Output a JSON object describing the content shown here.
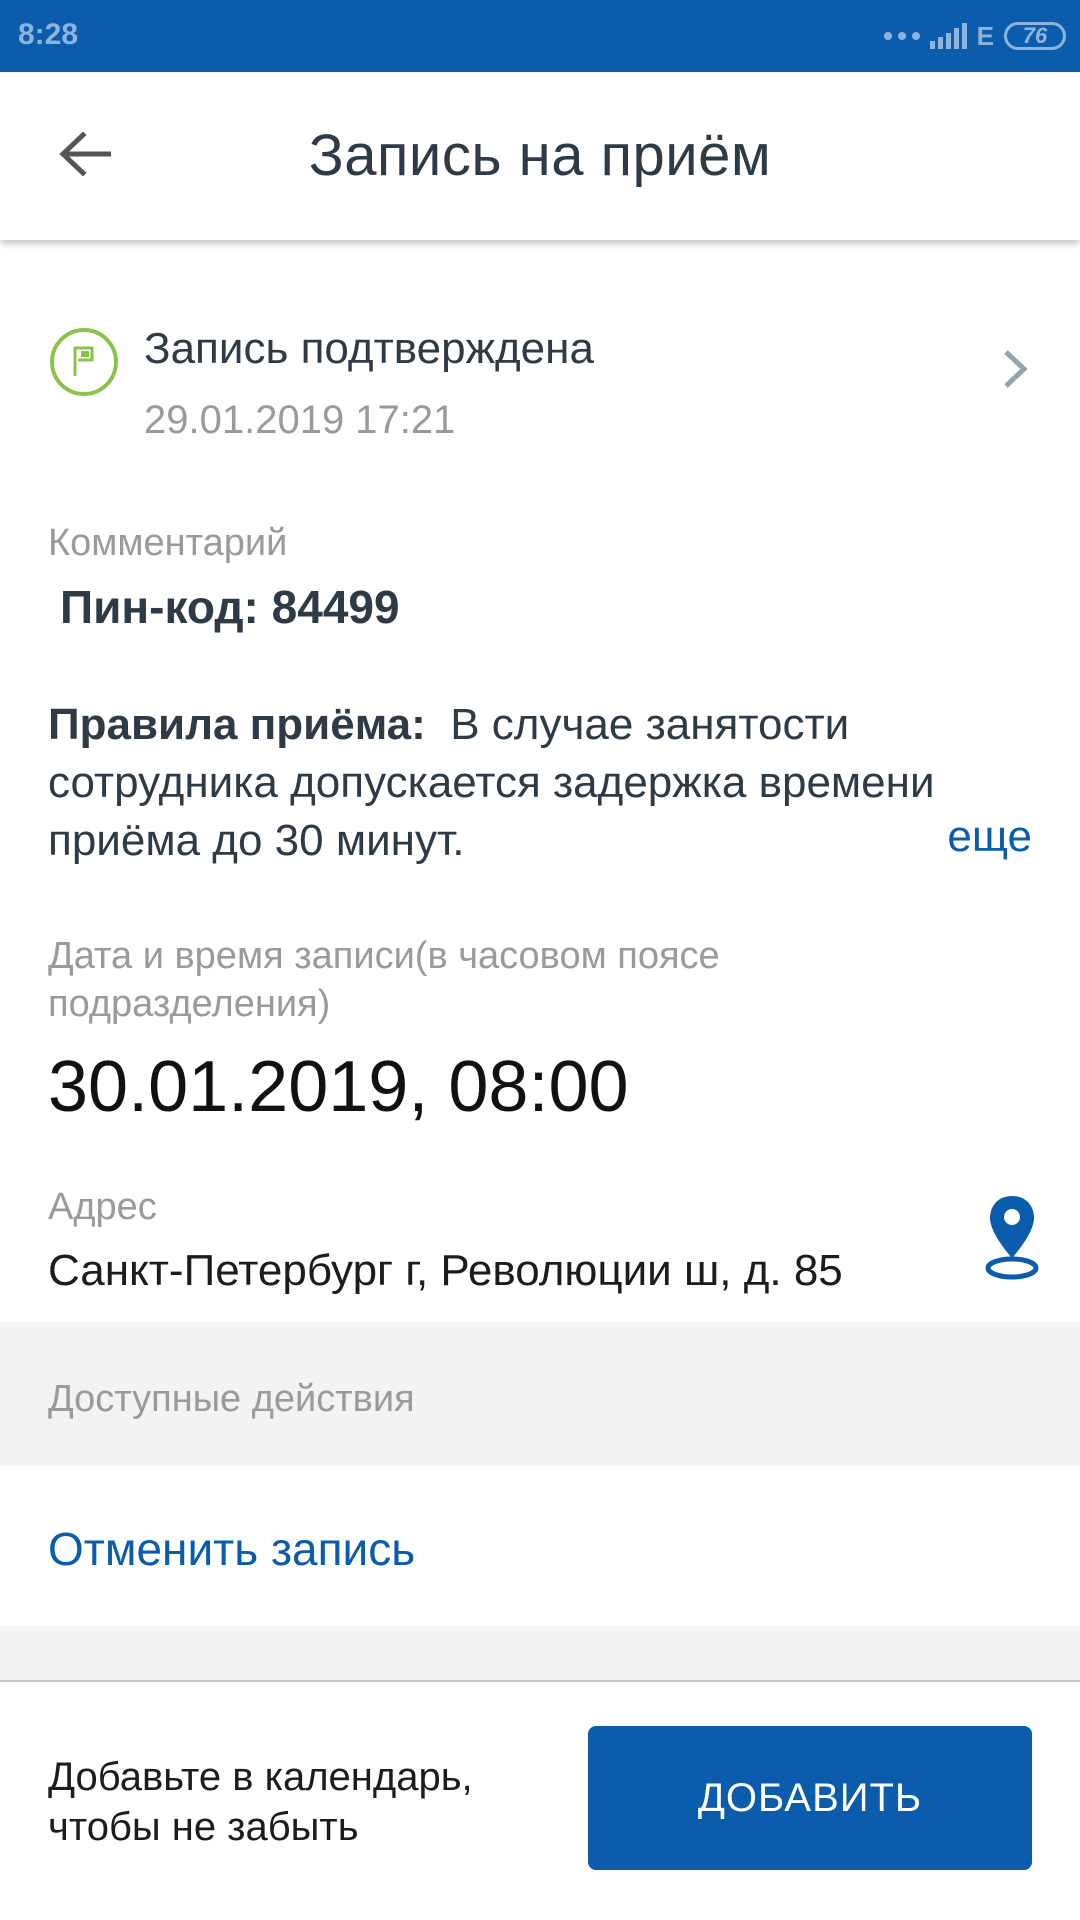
{
  "status_bar": {
    "time": "8:28",
    "network": "E",
    "battery": "76"
  },
  "app_bar": {
    "title": "Запись на приём"
  },
  "status": {
    "title": "Запись подтверждена",
    "date": "29.01.2019 17:21"
  },
  "comment": {
    "label": "Комментарий",
    "value": "Пин-код: 84499"
  },
  "rules": {
    "title": "Правила приёма:",
    "text": "В случае занятости сотрудника допускается задержка времени приёма до 30 минут.",
    "more": "еще"
  },
  "datetime": {
    "label": "Дата и время записи(в часовом поясе подразделения)",
    "value": "30.01.2019, 08:00"
  },
  "address": {
    "label": "Адрес",
    "value": "Санкт-Петербург г, Революции ш, д. 85"
  },
  "actions": {
    "header": "Доступные действия",
    "cancel": "Отменить запись"
  },
  "calendar": {
    "text": "Добавьте в календарь, чтобы не забыть",
    "button": "ДОБАВИТЬ"
  },
  "colors": {
    "primary": "#0b5cad",
    "confirm_green": "#8bc34a",
    "text_dark": "#2e3a46",
    "text_grey": "#9a9a9a"
  },
  "icons": {
    "back": "arrow-left-icon",
    "status": "flag-icon",
    "chevron": "chevron-right-icon",
    "map": "map-pin-icon"
  }
}
